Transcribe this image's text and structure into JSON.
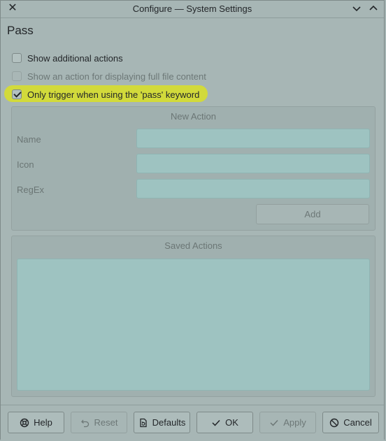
{
  "window": {
    "title": "Configure — System Settings",
    "icons": {
      "close": "close-icon",
      "minimize": "chevron-down-icon",
      "maximize": "chevron-up-icon"
    }
  },
  "page": {
    "heading": "Pass"
  },
  "options": {
    "show_additional_actions": {
      "label": "Show additional actions",
      "checked": false,
      "enabled": true
    },
    "show_full_file_action": {
      "label": "Show an action for displaying full file content",
      "checked": false,
      "enabled": false
    },
    "only_trigger_keyword": {
      "label": "Only trigger when using the 'pass' keyword",
      "checked": true,
      "enabled": true,
      "highlight_color": "#d4dc35"
    }
  },
  "new_action": {
    "title": "New Action",
    "name_label": "Name",
    "name_value": "",
    "icon_label": "Icon",
    "icon_value": "",
    "regex_label": "RegEx",
    "regex_value": "",
    "add_label": "Add"
  },
  "saved_actions": {
    "title": "Saved Actions",
    "items": []
  },
  "buttons": {
    "help": {
      "label": "Help",
      "icon": "help-icon"
    },
    "reset": {
      "label": "Reset",
      "icon": "undo-icon",
      "enabled": false
    },
    "defaults": {
      "label": "Defaults",
      "icon": "document-icon"
    },
    "ok": {
      "label": "OK",
      "icon": "check-icon"
    },
    "apply": {
      "label": "Apply",
      "icon": "check-icon",
      "enabled": false
    },
    "cancel": {
      "label": "Cancel",
      "icon": "cancel-icon"
    }
  },
  "colors": {
    "accent_highlight": "#d4dc35",
    "input_fill": "#9ec3c1",
    "window_bg": "#a7b6b5"
  }
}
